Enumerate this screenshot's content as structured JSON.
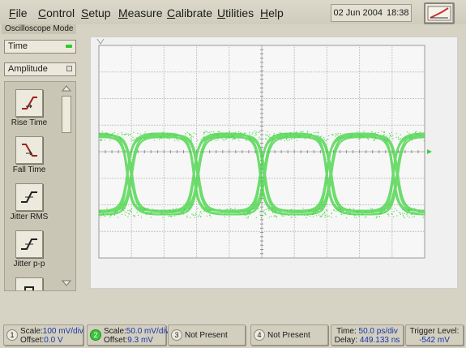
{
  "menu": {
    "items": [
      {
        "key": "F",
        "rest": "ile"
      },
      {
        "key": "C",
        "rest": "ontrol"
      },
      {
        "key": "S",
        "rest": "etup"
      },
      {
        "key": "M",
        "rest": "easure"
      },
      {
        "key": "C",
        "rest": "alibrate"
      },
      {
        "key": "U",
        "rest": "tilities"
      },
      {
        "key": "H",
        "rest": "elp"
      }
    ],
    "date": "02 Jun 2004",
    "time": "18:38"
  },
  "mode_label": "Oscilloscope Mode",
  "left_panel": {
    "dropdown1": "Time",
    "dropdown2": "Amplitude",
    "tools": [
      {
        "label": "Rise Time",
        "icon": "rise-time-icon"
      },
      {
        "label": "Fall Time",
        "icon": "fall-time-icon"
      },
      {
        "label": "Jitter RMS",
        "icon": "jitter-rms-icon"
      },
      {
        "label": "Jitter p-p",
        "icon": "jitter-pp-icon"
      }
    ]
  },
  "status": {
    "ch1": {
      "num": "1",
      "scale_label": "Scale:",
      "scale": "100 mV/div",
      "offset_label": "Offset:",
      "offset": "0.0 V"
    },
    "ch2": {
      "num": "2",
      "scale_label": "Scale:",
      "scale": "50.0 mV/div",
      "offset_label": "Offset:",
      "offset": "9.3 mV"
    },
    "ch3": {
      "num": "3",
      "text": "Not Present"
    },
    "ch4": {
      "num": "4",
      "text": "Not Present"
    },
    "time": {
      "label": "Time:",
      "value": "50.0 ps/div",
      "delay_label": "Delay:",
      "delay": "449.133 ns"
    },
    "trigger": {
      "label": "Trigger Level:",
      "value": "-542 mV"
    }
  },
  "colors": {
    "trace": "#3fd33f",
    "accent_blue": "#1b33a8"
  }
}
